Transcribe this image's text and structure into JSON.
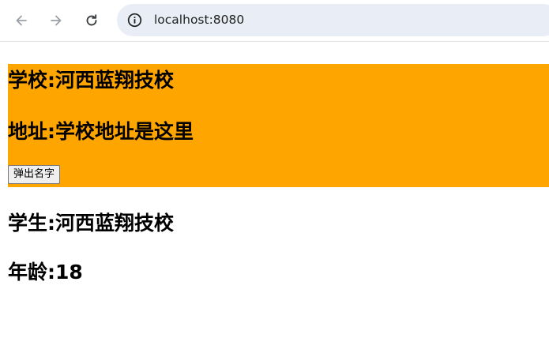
{
  "browser": {
    "url": "localhost:8080",
    "icons": {
      "back": "arrow-left-icon",
      "forward": "arrow-right-icon",
      "reload": "reload-icon",
      "site_info": "info-circle-icon"
    }
  },
  "school": {
    "name": "学校:河西蓝翔技校",
    "address": "地址:学校地址是这里",
    "button_label": "弹出名字",
    "background_color": "#ffa500"
  },
  "student": {
    "name": "学生:河西蓝翔技校",
    "age": "年龄:18"
  }
}
